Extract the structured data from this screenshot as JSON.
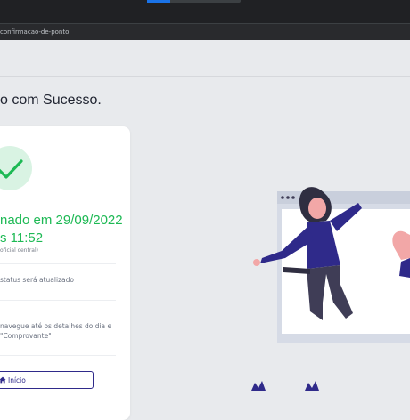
{
  "browser": {
    "url": "confirmacao-de-ponto"
  },
  "page": {
    "title": "o com Sucesso."
  },
  "card": {
    "success_line1": "nado em 29/09/2022",
    "success_line2": "s 11:52",
    "official_note": "oficial central)",
    "status_text": "status será atualizado",
    "details_line1": "navegue até os detalhes do dia e",
    "details_line2": "\"Comprovante\"",
    "home_button_label": "Início",
    "home_button_icon": "home-icon",
    "check_icon": "check-icon"
  },
  "colors": {
    "success_green": "#1db954",
    "success_circle": "#d9f3e3",
    "button_accent": "#2f2a8a",
    "page_background": "#e8eaed"
  }
}
